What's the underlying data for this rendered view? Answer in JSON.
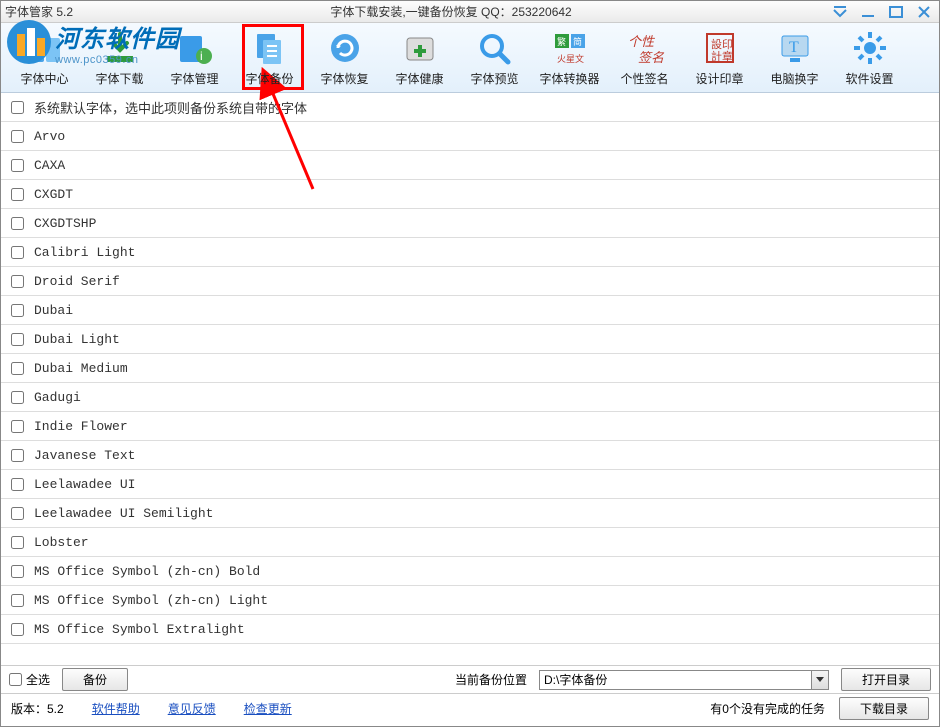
{
  "titlebar": {
    "title": "字体管家 5.2",
    "subtitle": "字体下载安装,一键备份恢复 QQ：253220642"
  },
  "watermark": {
    "line1": "河东软件园",
    "line2": "www.pc0359.cn"
  },
  "toolbar": {
    "items": [
      {
        "label": "字体中心",
        "icon": "font-center"
      },
      {
        "label": "字体下载",
        "icon": "download"
      },
      {
        "label": "字体管理",
        "icon": "manage"
      },
      {
        "label": "字体备份",
        "icon": "backup"
      },
      {
        "label": "字体恢复",
        "icon": "restore"
      },
      {
        "label": "字体健康",
        "icon": "health"
      },
      {
        "label": "字体预览",
        "icon": "preview"
      },
      {
        "label": "字体转换器",
        "icon": "convert"
      },
      {
        "label": "个性签名",
        "icon": "signature"
      },
      {
        "label": "设计印章",
        "icon": "stamp"
      },
      {
        "label": "电脑换字",
        "icon": "replace"
      },
      {
        "label": "软件设置",
        "icon": "settings"
      }
    ]
  },
  "list": {
    "rows": [
      "系统默认字体，选中此项则备份系统自带的字体",
      "Arvo",
      "CAXA",
      "CXGDT",
      "CXGDTSHP",
      "Calibri Light",
      "Droid Serif",
      "Dubai",
      "Dubai Light",
      "Dubai Medium",
      "Gadugi",
      "Indie Flower",
      "Javanese Text",
      "Leelawadee UI",
      "Leelawadee UI Semilight",
      "Lobster",
      "MS Office Symbol (zh-cn) Bold",
      "MS Office Symbol (zh-cn) Light",
      "MS Office Symbol Extralight"
    ]
  },
  "bottom": {
    "select_all": "全选",
    "backup_btn": "备份",
    "path_label": "当前备份位置",
    "path_value": "D:\\字体备份",
    "open_dir_btn": "打开目录"
  },
  "status": {
    "version_label": "版本：5.2",
    "help_link": "软件帮助",
    "feedback_link": "意见反馈",
    "update_link": "检查更新",
    "tasks_text": "有0个没有完成的任务",
    "download_list_btn": "下载目录"
  }
}
